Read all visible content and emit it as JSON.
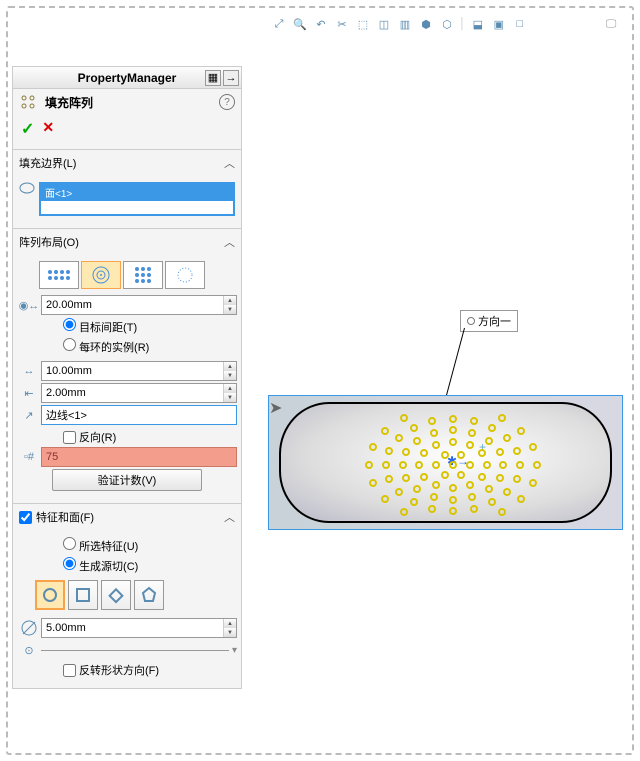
{
  "pm": {
    "title": "PropertyManager",
    "feature": "填充阵列",
    "ok": "✓",
    "cancel": "✕",
    "help": "?"
  },
  "sec1": {
    "title": "填充边界(L)",
    "item": "面<1>"
  },
  "sec2": {
    "title": "阵列布局(O)",
    "spacing": "20.00mm",
    "rad_target": "目标间距(T)",
    "rad_loop": "每环的实例(R)",
    "loopSpacing": "10.00mm",
    "margin": "2.00mm",
    "edge": "边线<1>",
    "reverse": "反向(R)",
    "count": "75",
    "verify": "验证计数(V)"
  },
  "sec3": {
    "title": "特征和面(F)",
    "rad_sel": "所选特征(U)",
    "rad_seed": "生成源切(C)",
    "diameter": "5.00mm",
    "revshape": "反转形状方向(F)"
  },
  "callout": {
    "text": "方向一"
  }
}
